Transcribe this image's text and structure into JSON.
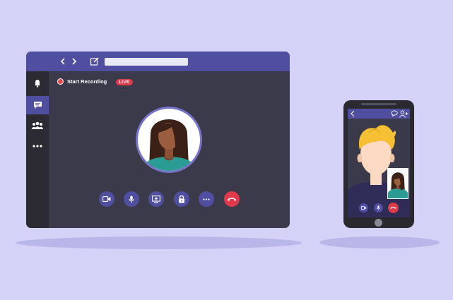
{
  "desktop_window": {
    "toolbar": {
      "back_icon": "chevron-left-icon",
      "forward_icon": "chevron-right-icon",
      "compose_icon": "compose-icon",
      "address_bar": ""
    },
    "sidebar": {
      "items": [
        {
          "icon": "bell-icon",
          "active": false
        },
        {
          "icon": "chat-icon",
          "active": true
        },
        {
          "icon": "team-icon",
          "active": false
        },
        {
          "icon": "more-dots-icon",
          "active": false
        }
      ]
    },
    "recording": {
      "label": "Start Recording",
      "live_badge": "LIVE"
    },
    "call_controls": [
      {
        "icon": "video-camera-icon"
      },
      {
        "icon": "microphone-icon"
      },
      {
        "icon": "share-screen-icon"
      },
      {
        "icon": "lock-icon"
      },
      {
        "icon": "more-dots-icon"
      },
      {
        "icon": "end-call-icon"
      }
    ]
  },
  "phone": {
    "header_icons": [
      "chevron-left-icon",
      "chat-bubble-icon",
      "add-user-icon"
    ],
    "call_controls": [
      "video-camera-icon",
      "microphone-icon",
      "end-call-icon"
    ]
  },
  "colors": {
    "background": "#d4d2f6",
    "accent": "#4f4ea0",
    "panel": "#3b3a4a",
    "danger": "#e03a4a"
  }
}
